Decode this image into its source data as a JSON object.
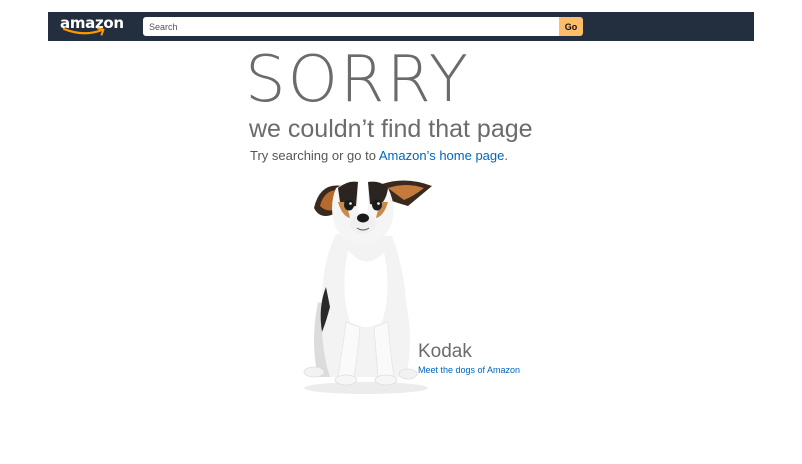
{
  "header": {
    "logo_text": "amazon",
    "search": {
      "placeholder": "Search",
      "value": ""
    },
    "go_label": "Go"
  },
  "error": {
    "title": "SORRY",
    "subtitle": "we couldn’t find that page",
    "hint_prefix": "Try searching or go to ",
    "home_link": "Amazon’s home page",
    "hint_suffix": "."
  },
  "dog": {
    "name": "Kodak",
    "link": "Meet the dogs of Amazon"
  },
  "colors": {
    "header_bg": "#232f3e",
    "go_button": "#febd69",
    "link": "#0066c0",
    "text_gray": "#6b6b6b",
    "logo_smile": "#ff9900"
  }
}
